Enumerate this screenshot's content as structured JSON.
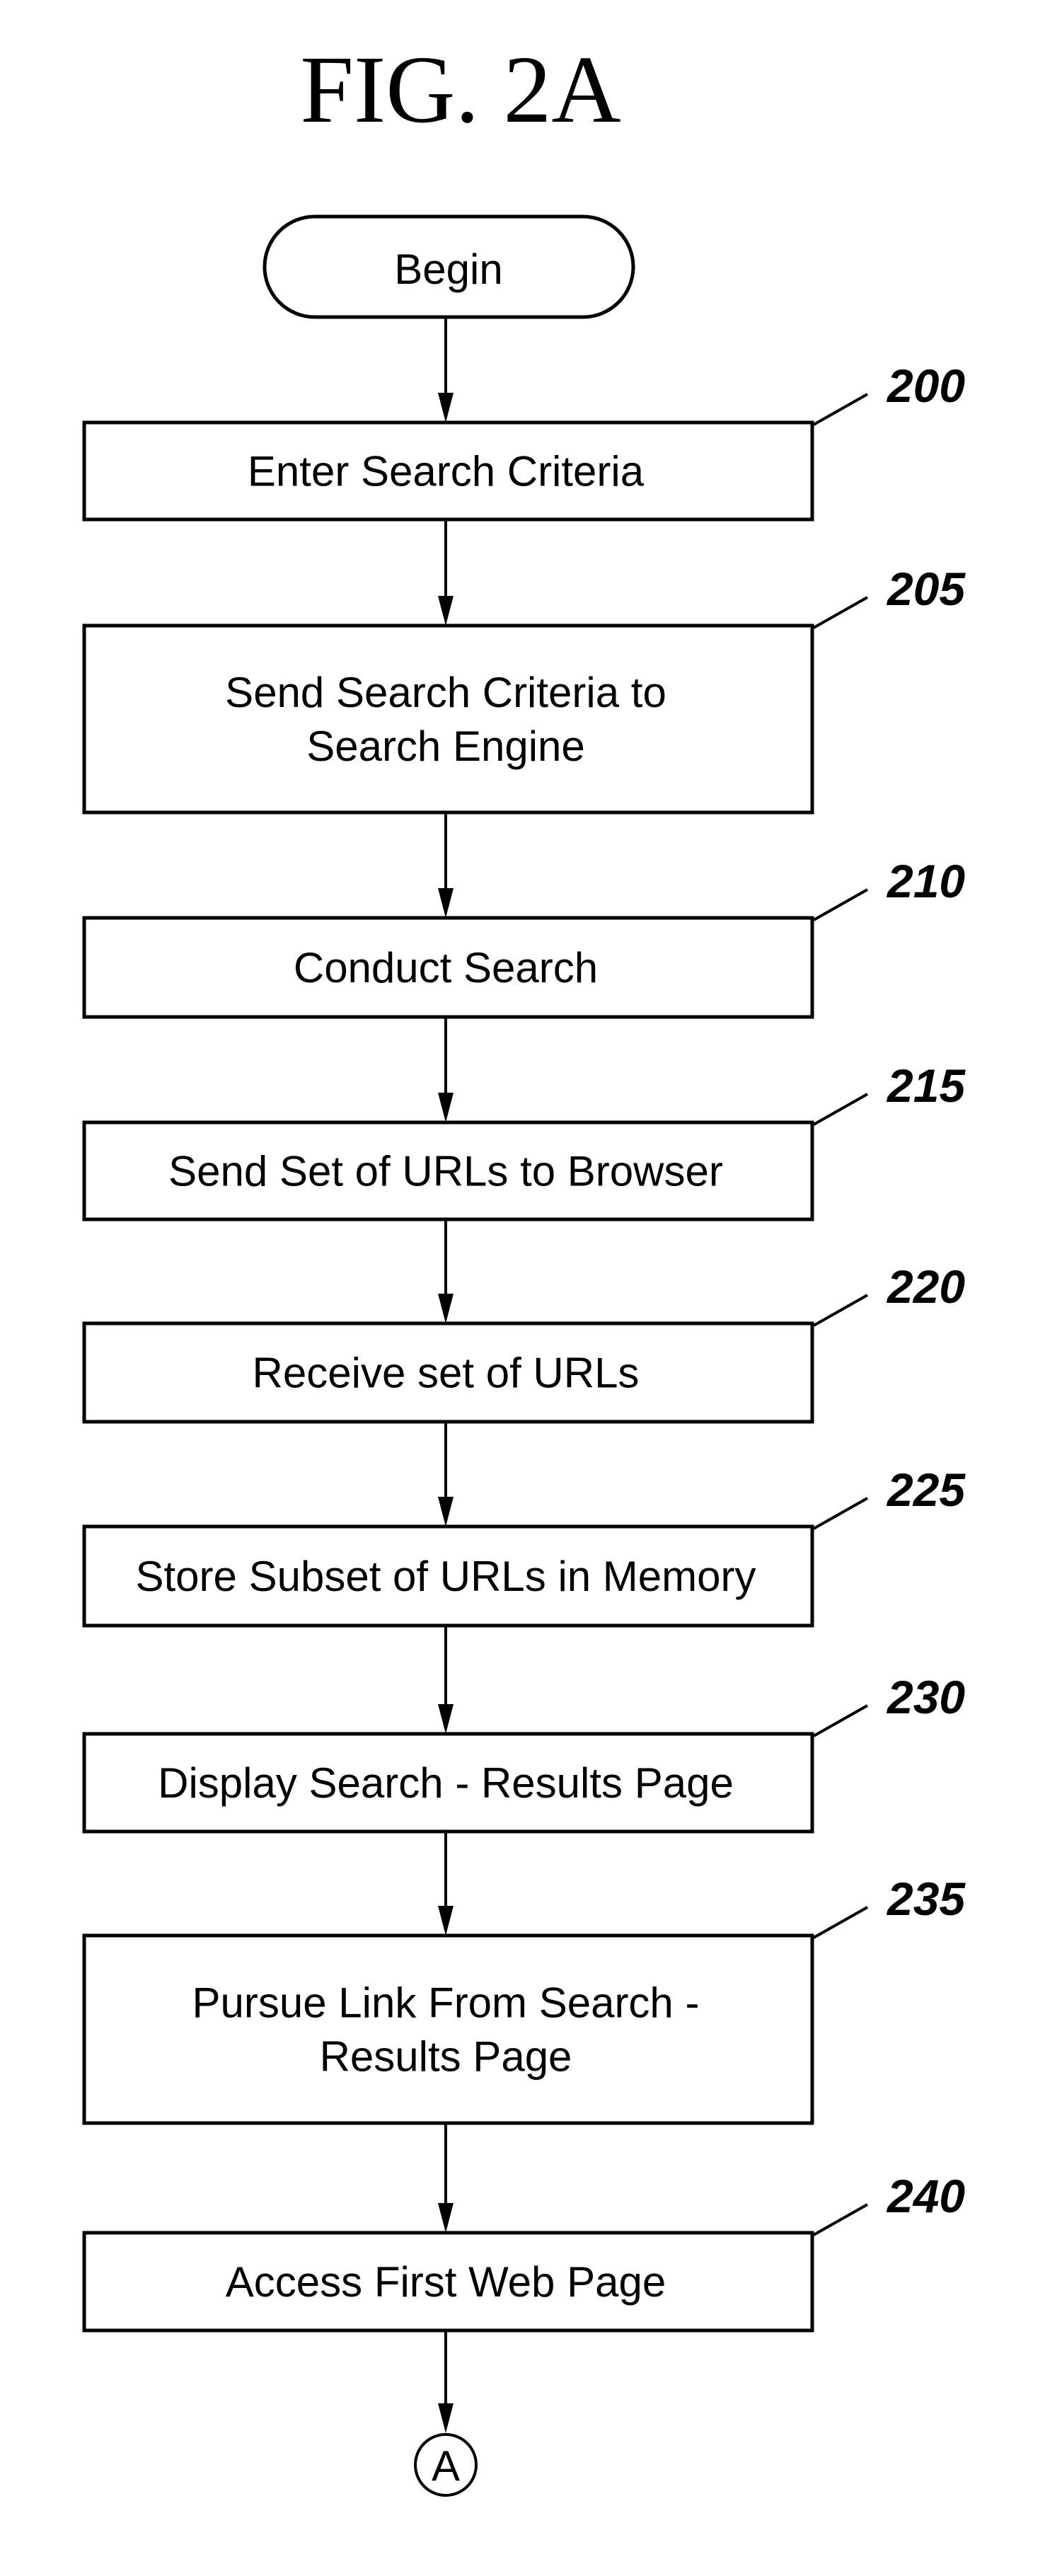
{
  "figure": {
    "title": "FIG. 2A"
  },
  "start": {
    "label": "Begin"
  },
  "steps": [
    {
      "ref": "200",
      "lines": [
        "Enter Search Criteria"
      ]
    },
    {
      "ref": "205",
      "lines": [
        "Send Search Criteria to",
        "Search Engine"
      ]
    },
    {
      "ref": "210",
      "lines": [
        "Conduct Search"
      ]
    },
    {
      "ref": "215",
      "lines": [
        "Send Set of URLs to Browser"
      ]
    },
    {
      "ref": "220",
      "lines": [
        "Receive set of URLs"
      ]
    },
    {
      "ref": "225",
      "lines": [
        "Store Subset of URLs in Memory"
      ]
    },
    {
      "ref": "230",
      "lines": [
        "Display Search - Results Page"
      ]
    },
    {
      "ref": "235",
      "lines": [
        "Pursue Link From Search -",
        "Results Page"
      ]
    },
    {
      "ref": "240",
      "lines": [
        "Access First Web Page"
      ]
    }
  ],
  "end_connector": {
    "label": "A"
  },
  "colors": {
    "ink": "#000000",
    "paper": "#ffffff"
  }
}
